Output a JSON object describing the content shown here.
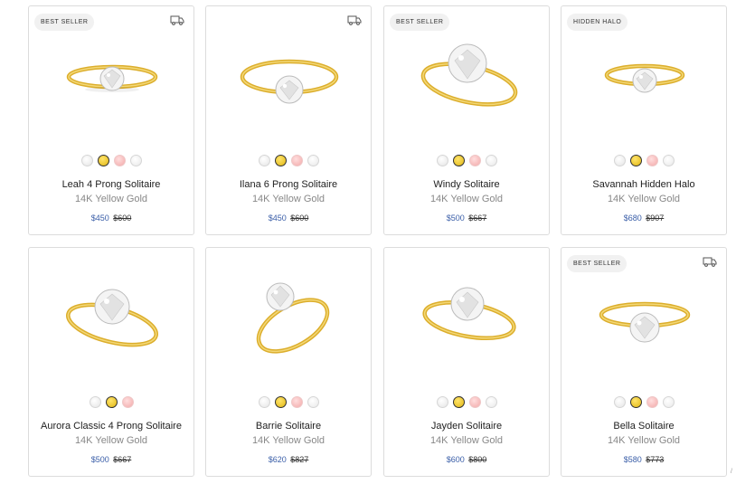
{
  "products": [
    {
      "name": "Leah 4 Prong Solitaire",
      "metal": "14K Yellow Gold",
      "sale_price": "$450",
      "original_price": "$600",
      "badge": "BEST SELLER",
      "shipping_icon": true
    },
    {
      "name": "Ilana 6 Prong Solitaire",
      "metal": "14K Yellow Gold",
      "sale_price": "$450",
      "original_price": "$600",
      "badge": "",
      "shipping_icon": true
    },
    {
      "name": "Windy Solitaire",
      "metal": "14K Yellow Gold",
      "sale_price": "$500",
      "original_price": "$667",
      "badge": "BEST SELLER",
      "shipping_icon": false
    },
    {
      "name": "Savannah Hidden Halo",
      "metal": "14K Yellow Gold",
      "sale_price": "$680",
      "original_price": "$907",
      "badge": "HIDDEN HALO",
      "shipping_icon": false
    },
    {
      "name": "Aurora Classic 4 Prong Solitaire",
      "metal": "14K Yellow Gold",
      "sale_price": "$500",
      "original_price": "$667",
      "badge": "",
      "shipping_icon": false
    },
    {
      "name": "Barrie Solitaire",
      "metal": "14K Yellow Gold",
      "sale_price": "$620",
      "original_price": "$827",
      "badge": "",
      "shipping_icon": false
    },
    {
      "name": "Jayden Solitaire",
      "metal": "14K Yellow Gold",
      "sale_price": "$600",
      "original_price": "$800",
      "badge": "",
      "shipping_icon": false
    },
    {
      "name": "Bella Solitaire",
      "metal": "14K Yellow Gold",
      "sale_price": "$580",
      "original_price": "$773",
      "badge": "BEST SELLER",
      "shipping_icon": true
    }
  ],
  "metal_swatches": [
    "white-gold",
    "yellow-gold",
    "rose-gold",
    "platinum"
  ],
  "selected_swatch": "yellow-gold",
  "colors": {
    "sale_price": "#3a5ea8",
    "gold": "#e0b41c",
    "border": "#dcdcdc"
  },
  "corner_mark": "/"
}
